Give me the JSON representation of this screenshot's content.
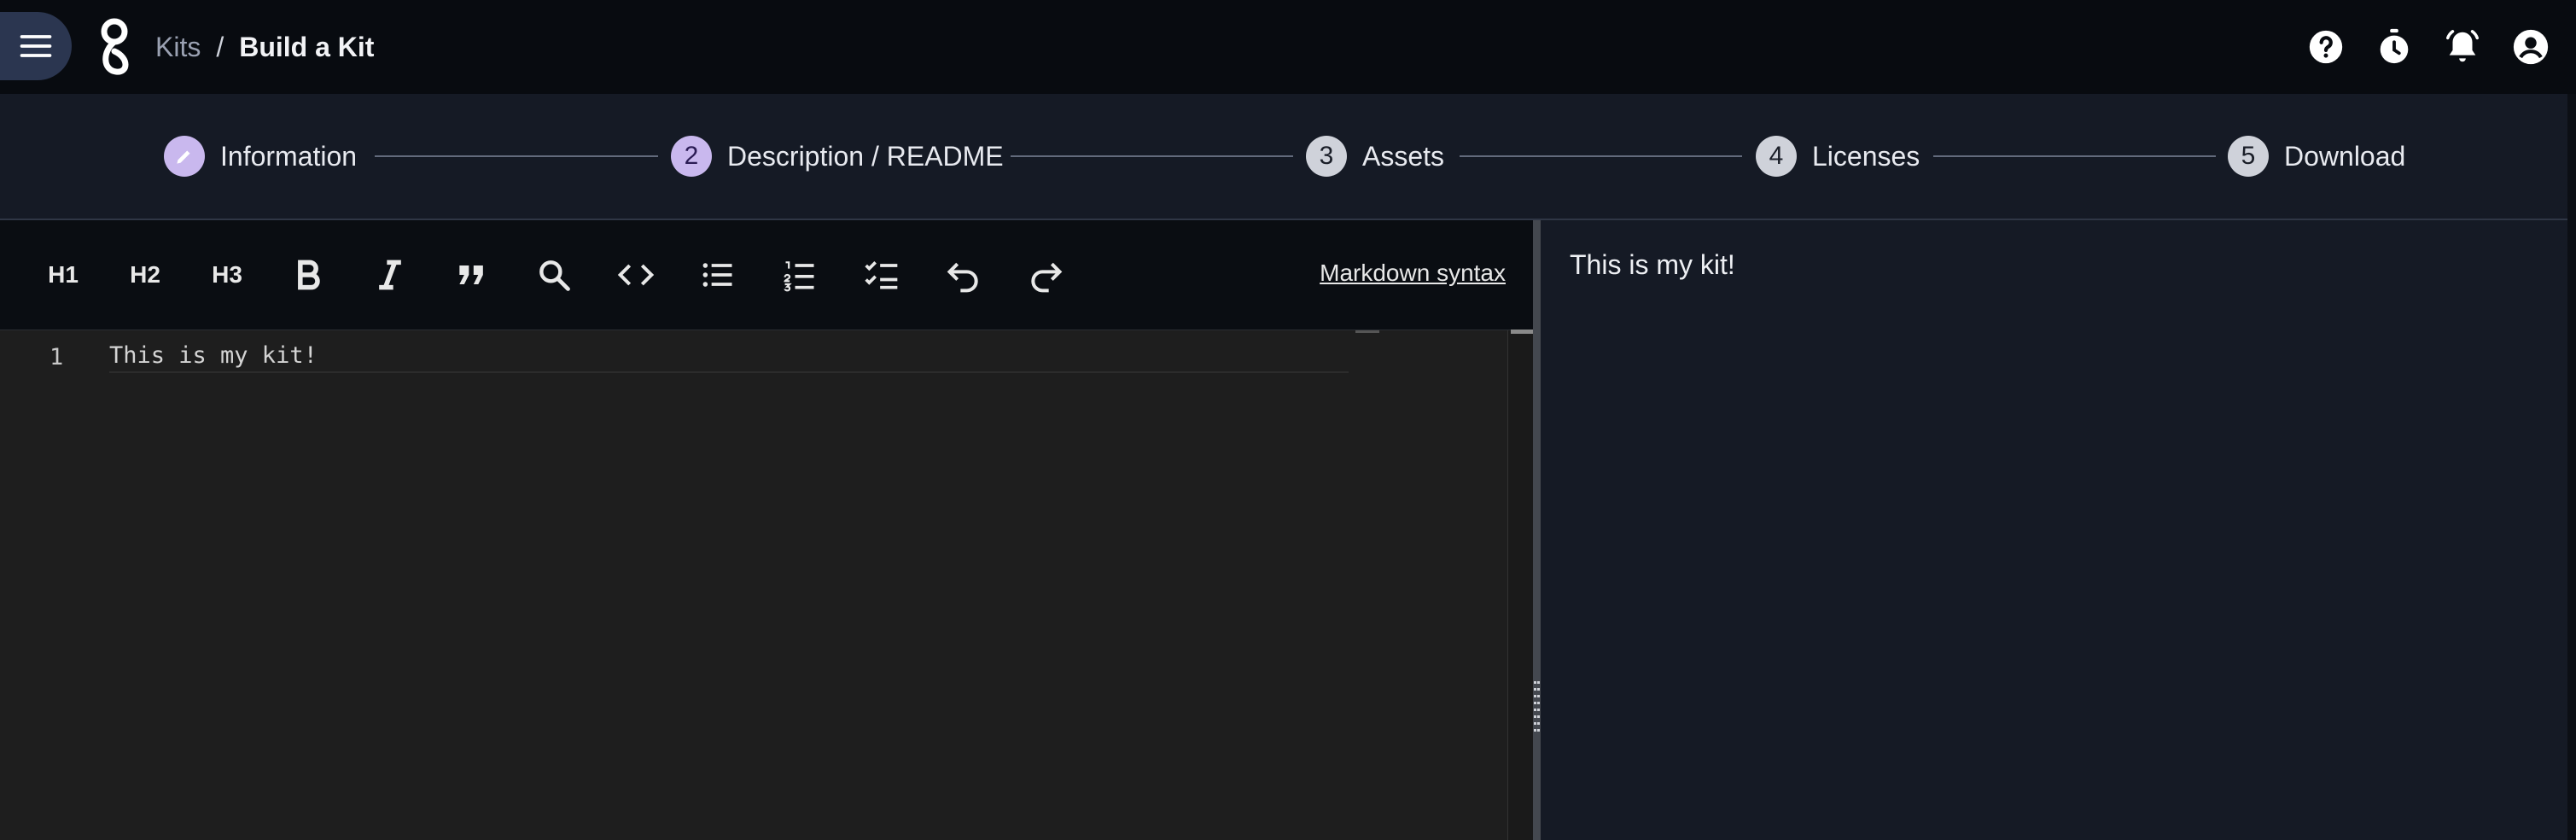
{
  "app": {
    "breadcrumb": {
      "parent": "Kits",
      "separator": "/",
      "current": "Build a Kit"
    },
    "top_icons": [
      "help-icon",
      "timer-icon",
      "notifications-icon",
      "account-icon"
    ]
  },
  "stepper": {
    "steps": [
      {
        "number": "",
        "label": "Information",
        "state": "completed",
        "icon": "pencil-icon"
      },
      {
        "number": "2",
        "label": "Description / README",
        "state": "active"
      },
      {
        "number": "3",
        "label": "Assets",
        "state": "todo"
      },
      {
        "number": "4",
        "label": "Licenses",
        "state": "todo"
      },
      {
        "number": "5",
        "label": "Download",
        "state": "todo"
      }
    ]
  },
  "toolbar": {
    "h1": "H1",
    "h2": "H2",
    "h3": "H3",
    "buttons": [
      "bold-icon",
      "italic-icon",
      "quote-icon",
      "search-icon",
      "code-icon",
      "bullet-list-icon",
      "numbered-list-icon",
      "checklist-icon",
      "undo-icon",
      "redo-icon"
    ],
    "syntax_link": "Markdown syntax"
  },
  "editor": {
    "lines": [
      {
        "number": "1",
        "text": "This is my kit!"
      }
    ]
  },
  "preview": {
    "text": "This is my kit!"
  },
  "colors": {
    "accent": "#c9b8ee",
    "background": "#0c0f15",
    "panel": "#151a25",
    "editor": "#1e1e1e"
  }
}
